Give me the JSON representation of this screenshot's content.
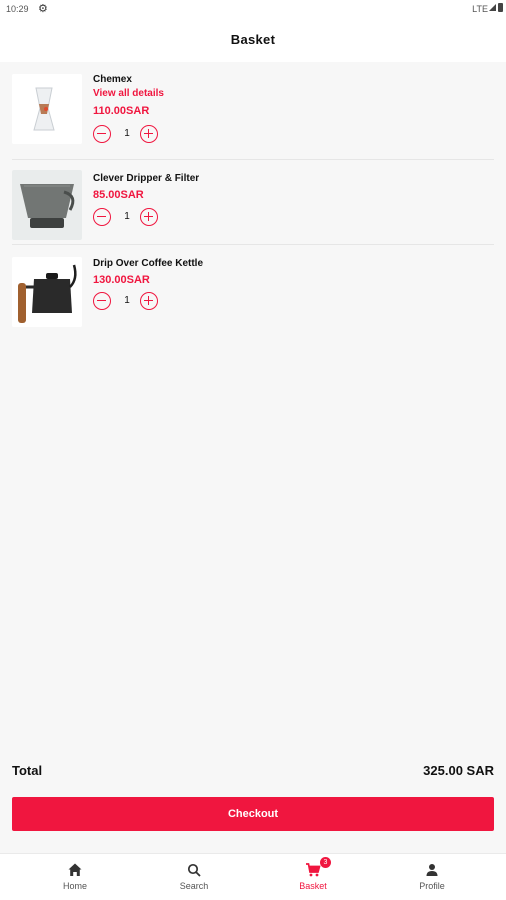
{
  "status_bar": {
    "time": "10:29",
    "network": "LTE"
  },
  "app_bar": {
    "title": "Basket"
  },
  "cart": {
    "items": [
      {
        "name": "Chemex",
        "details_link": "View all details",
        "price": "110.00SAR",
        "quantity": "1"
      },
      {
        "name": "Clever Dripper & Filter",
        "price": "85.00SAR",
        "quantity": "1"
      },
      {
        "name": "Drip Over Coffee Kettle",
        "price": "130.00SAR",
        "quantity": "1"
      }
    ]
  },
  "summary": {
    "total_label": "Total",
    "total_value": "325.00 SAR"
  },
  "checkout": {
    "label": "Checkout"
  },
  "bottom_nav": {
    "items": [
      {
        "label": "Home",
        "icon": "home-icon"
      },
      {
        "label": "Search",
        "icon": "search-icon"
      },
      {
        "label": "Basket",
        "icon": "cart-icon",
        "badge": "3"
      },
      {
        "label": "Profile",
        "icon": "person-icon"
      }
    ],
    "active": "Basket"
  },
  "colors": {
    "accent": "#f0163f",
    "background": "#f7f7f7"
  }
}
